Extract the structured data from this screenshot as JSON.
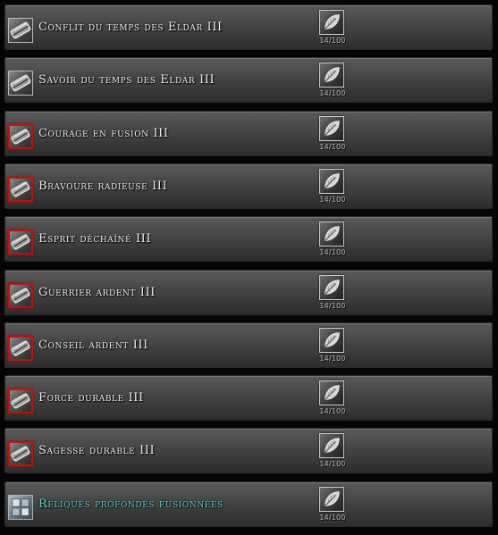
{
  "items": [
    {
      "name": "Conflit du temps des Eldar III",
      "count": "14/100",
      "icon": "scroll-icon",
      "frame": "plain",
      "name_color": "#f2f2f2"
    },
    {
      "name": "Savoir du temps des Eldar III",
      "count": "14/100",
      "icon": "scroll-icon",
      "frame": "plain",
      "name_color": "#f2f2f2"
    },
    {
      "name": "Courage en fusion III",
      "count": "14/100",
      "icon": "scroll-icon",
      "frame": "red",
      "name_color": "#f2f2f2"
    },
    {
      "name": "Bravoure radieuse III",
      "count": "14/100",
      "icon": "scroll-icon",
      "frame": "red",
      "name_color": "#f2f2f2"
    },
    {
      "name": "Esprit déchaîné III",
      "count": "14/100",
      "icon": "scroll-icon",
      "frame": "red",
      "name_color": "#f2f2f2"
    },
    {
      "name": "Guerrier ardent III",
      "count": "14/100",
      "icon": "scroll-icon",
      "frame": "red",
      "name_color": "#f2f2f2"
    },
    {
      "name": "Conseil ardent III",
      "count": "14/100",
      "icon": "scroll-icon",
      "frame": "red",
      "name_color": "#f2f2f2"
    },
    {
      "name": "Force durable III",
      "count": "14/100",
      "icon": "scroll-icon",
      "frame": "red",
      "name_color": "#f2f2f2"
    },
    {
      "name": "Sagesse durable III",
      "count": "14/100",
      "icon": "scroll-icon",
      "frame": "red",
      "name_color": "#f2f2f2"
    },
    {
      "name": "Reliques profondes fusionnées",
      "count": "14/100",
      "icon": "relic-icon",
      "frame": "relic",
      "name_color": "#6ed0c8"
    }
  ],
  "slot_icon": "leaf-icon"
}
